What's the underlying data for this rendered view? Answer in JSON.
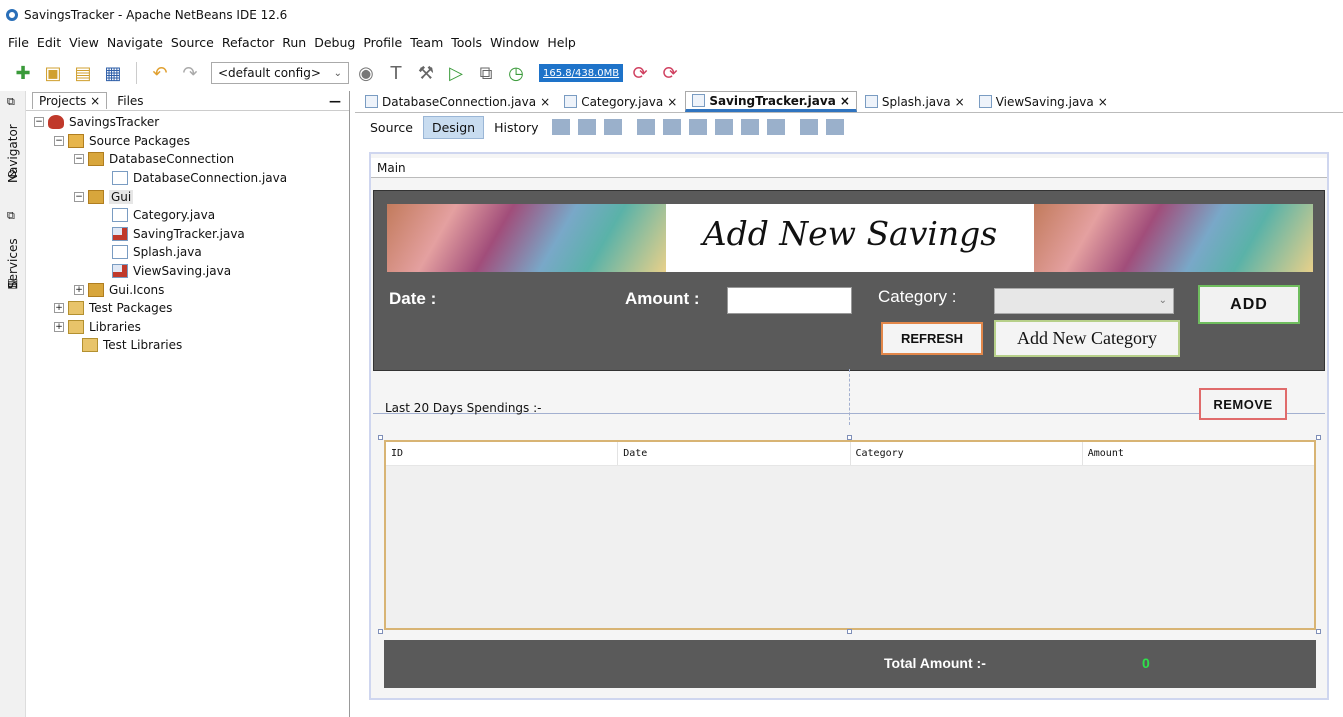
{
  "window": {
    "title": "SavingsTracker - Apache NetBeans IDE 12.6"
  },
  "menu": [
    "File",
    "Edit",
    "View",
    "Navigate",
    "Source",
    "Refactor",
    "Run",
    "Debug",
    "Profile",
    "Team",
    "Tools",
    "Window",
    "Help"
  ],
  "toolbar": {
    "config": "<default config>",
    "memory": "165.8/438.0MB"
  },
  "side_tabs": {
    "navigator": "Navigator",
    "services": "Services"
  },
  "project_panel": {
    "tabs": [
      "Projects",
      "Files"
    ],
    "tree": [
      {
        "label": "SavingsTracker",
        "depth": 0,
        "icon": "project-icon"
      },
      {
        "label": "Source Packages",
        "depth": 1,
        "icon": "source-packages-icon"
      },
      {
        "label": "DatabaseConnection",
        "depth": 2,
        "icon": "package-icon"
      },
      {
        "label": "DatabaseConnection.java",
        "depth": 3,
        "icon": "java-file-icon"
      },
      {
        "label": "Gui",
        "depth": 2,
        "icon": "package-icon"
      },
      {
        "label": "Category.java",
        "depth": 3,
        "icon": "java-file-icon"
      },
      {
        "label": "SavingTracker.java",
        "depth": 3,
        "icon": "java-file-icon"
      },
      {
        "label": "Splash.java",
        "depth": 3,
        "icon": "java-file-icon"
      },
      {
        "label": "ViewSaving.java",
        "depth": 3,
        "icon": "java-file-icon"
      },
      {
        "label": "Gui.Icons",
        "depth": 2,
        "icon": "package-icon"
      },
      {
        "label": "Test Packages",
        "depth": 1,
        "icon": "test-packages-icon"
      },
      {
        "label": "Libraries",
        "depth": 1,
        "icon": "libraries-icon"
      },
      {
        "label": "Test Libraries",
        "depth": 1,
        "icon": "test-libraries-icon"
      }
    ]
  },
  "editor": {
    "tabs": [
      "DatabaseConnection.java",
      "Category.java",
      "SavingTracker.java",
      "Splash.java",
      "ViewSaving.java"
    ],
    "active_tab": "SavingTracker.java",
    "modes": [
      "Source",
      "Design",
      "History"
    ],
    "active_mode": "Design"
  },
  "form": {
    "main_label": "Main",
    "banner_title": "Add New Savings",
    "date_label": "Date :",
    "amount_label": "Amount :",
    "category_label": "Category :",
    "add_button": "ADD",
    "refresh_button": "REFRESH",
    "new_category_button": "Add New Category",
    "list_label": "Last 20 Days Spendings :-",
    "remove_button": "REMOVE",
    "table_columns": [
      "ID",
      "Date",
      "Category",
      "Amount"
    ],
    "total_label": "Total Amount :-",
    "total_value": "0"
  }
}
